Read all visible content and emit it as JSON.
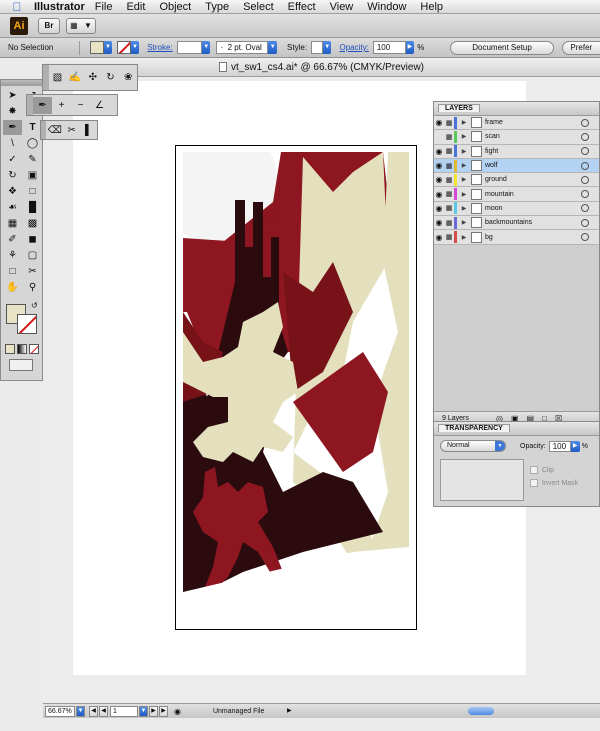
{
  "menubar": {
    "app_name": "Illustrator",
    "items": [
      "File",
      "Edit",
      "Object",
      "Type",
      "Select",
      "Effect",
      "View",
      "Window",
      "Help"
    ]
  },
  "appbar": {
    "logo": "Ai",
    "bridge_label": "Br"
  },
  "control_bar": {
    "selection_label": "No Selection",
    "stroke_label": "Stroke:",
    "brush_value": "2 pt. Oval",
    "style_label": "Style:",
    "opacity_label": "Opacity:",
    "opacity_value": "100",
    "percent": "%",
    "document_setup": "Document Setup",
    "preferences": "Prefer"
  },
  "document": {
    "tab_title": "vt_sw1_cs4.ai* @ 66.67% (CMYK/Preview)"
  },
  "artwork_colors": {
    "dark": "#2b0b0e",
    "red": "#8e1621",
    "mid_red": "#761218",
    "cream": "#e4e0bd",
    "moon": "#f4f4f4"
  },
  "layers_panel": {
    "tab": "LAYERS",
    "count_label": "9 Layers",
    "layers": [
      {
        "name": "frame",
        "color": "#4b72d8",
        "eye": true,
        "selected": false
      },
      {
        "name": "scan",
        "color": "#57c957",
        "eye": false,
        "selected": false
      },
      {
        "name": "fight",
        "color": "#4b72d8",
        "eye": true,
        "selected": false
      },
      {
        "name": "wolf",
        "color": "#e0b730",
        "eye": true,
        "selected": true
      },
      {
        "name": "ground",
        "color": "#f0e530",
        "eye": true,
        "selected": false
      },
      {
        "name": "mountain",
        "color": "#d44ad6",
        "eye": true,
        "selected": false
      },
      {
        "name": "moon",
        "color": "#5ac8e6",
        "eye": true,
        "selected": false
      },
      {
        "name": "backmountains",
        "color": "#6a6ad8",
        "eye": true,
        "selected": false
      },
      {
        "name": "bg",
        "color": "#d84a4a",
        "eye": true,
        "selected": false
      }
    ]
  },
  "transparency_panel": {
    "tab": "TRANSPARENCY",
    "blend_mode": "Normal",
    "opacity_label": "Opacity:",
    "opacity_value": "100",
    "percent": "%",
    "clip_label": "Clip",
    "invert_mask_label": "Invert Mask"
  },
  "status_bar": {
    "zoom": "66.67%",
    "page": "1",
    "status_text": "Unmanaged File"
  }
}
